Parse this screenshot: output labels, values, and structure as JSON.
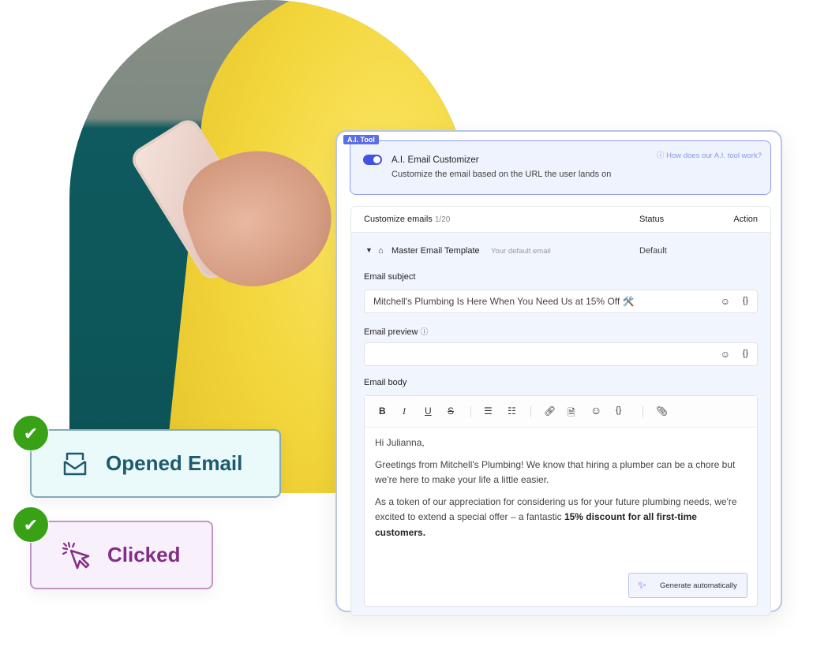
{
  "ai_tool": {
    "tag": "A.I. Tool",
    "title": "A.I. Email Customizer",
    "subtitle": "Customize the email based on the URL the user lands on",
    "help": "How does our A.I. tool work?",
    "enabled": true
  },
  "table": {
    "col1": "Customize emails",
    "count": "1/20",
    "col2": "Status",
    "col3": "Action",
    "row": {
      "name": "Master Email Template",
      "note": "Your default email",
      "status": "Default"
    }
  },
  "fields": {
    "subject_label": "Email subject",
    "subject_value": "Mitchell's Plumbing Is Here When You Need Us at 15% Off 🛠️",
    "preview_label": "Email preview",
    "preview_value": "",
    "body_label": "Email body"
  },
  "body": {
    "greeting": "Hi Julianna,",
    "p1": "Greetings from Mitchell's Plumbing! We know that hiring a plumber can be a chore but we're here to make your life a little easier.",
    "p2": "As a token of our appreciation for considering us for your future plumbing needs, we're excited to extend a special offer – a fantastic ",
    "p2_bold": "15% discount for all first-time customers."
  },
  "generate_label": "Generate automatically",
  "cards": {
    "opened": "Opened Email",
    "clicked": "Clicked"
  },
  "colors": {
    "accent": "#4353e0",
    "success": "#38a116",
    "opened": "#1e5a6e",
    "clicked": "#842d86"
  }
}
